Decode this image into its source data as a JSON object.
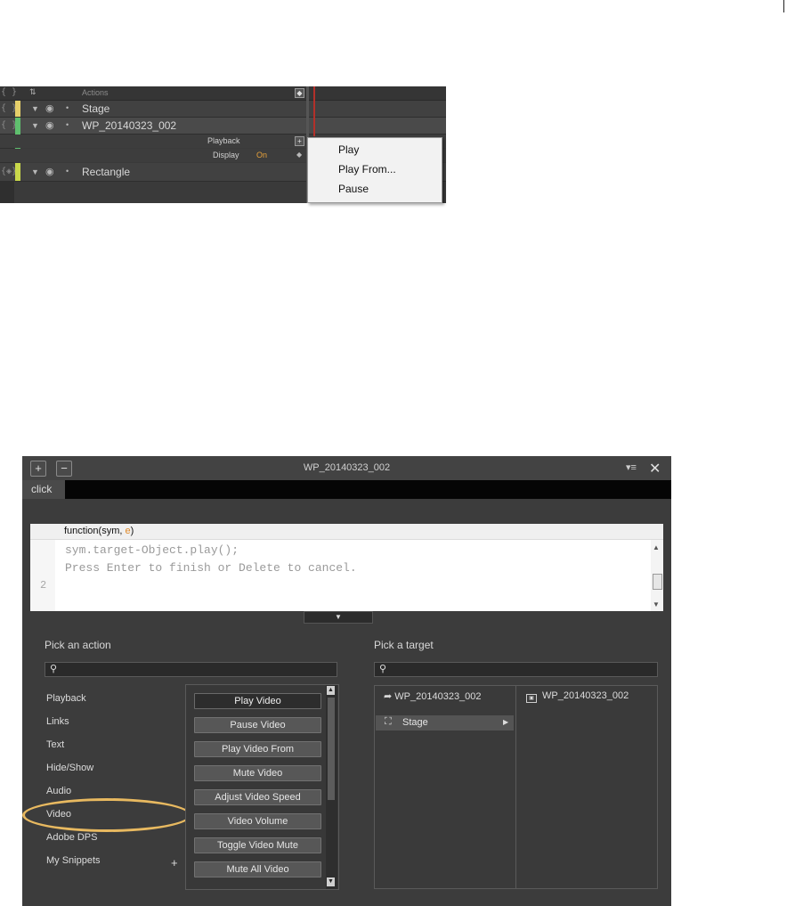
{
  "timeline": {
    "rows": {
      "actions": "Actions",
      "stage": "Stage",
      "wp": "WP_20140323_002",
      "playback": "Playback",
      "display": "Display",
      "display_value": "On",
      "rectangle": "Rectangle"
    },
    "colors": {
      "stage": "#e6cf6a",
      "wp": "#5fbf6e",
      "rectangle": "#c9d84a",
      "playhead": "#b3302a"
    }
  },
  "context_menu": {
    "items": [
      "Play",
      "Play From...",
      "Pause"
    ]
  },
  "dialog": {
    "title": "WP_20140323_002",
    "add_button": "+",
    "remove_button": "−",
    "tab": "click",
    "code": {
      "signature_prefix": "function(sym, ",
      "signature_arg": "e",
      "signature_suffix": ")",
      "line1": "sym.target-Object.play();",
      "line2": "Press Enter to finish or Delete to cancel.",
      "line_number": "2"
    },
    "pick_action": {
      "title": "Pick an action",
      "categories": [
        "Playback",
        "Links",
        "Text",
        "Hide/Show",
        "Audio",
        "Video",
        "Adobe DPS",
        "My Snippets"
      ],
      "selected_category": "Video",
      "actions": [
        "Play Video",
        "Pause Video",
        "Play Video From",
        "Mute Video",
        "Adjust Video Speed",
        "Video Volume",
        "Toggle Video Mute",
        "Mute All Video"
      ],
      "selected_action": "Play Video"
    },
    "pick_target": {
      "title": "Pick a target",
      "left_item": "WP_20140323_002",
      "stage": "Stage",
      "right_item": "WP_20140323_002"
    }
  }
}
